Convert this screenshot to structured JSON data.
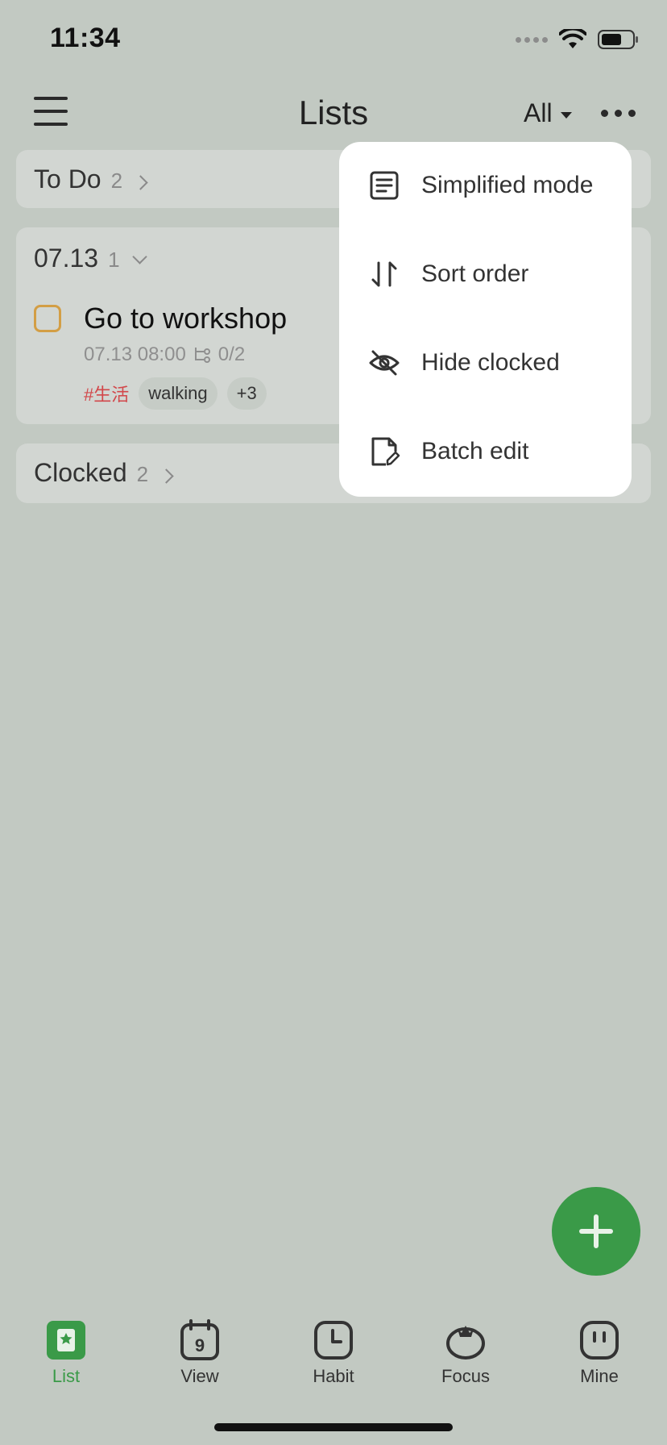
{
  "status_bar": {
    "time": "11:34"
  },
  "header": {
    "title": "Lists",
    "filter_label": "All"
  },
  "sections": {
    "todo": {
      "title": "To Do",
      "count": "2"
    },
    "date": {
      "title": "07.13",
      "count": "1"
    },
    "clocked": {
      "title": "Clocked",
      "count": "2"
    }
  },
  "task": {
    "title": "Go to workshop",
    "datetime": "07.13 08:00",
    "subtask_progress": "0/2",
    "tag_primary": "#生活",
    "tag_secondary": "walking",
    "tag_more": "+3"
  },
  "menu": {
    "items": [
      {
        "label": "Simplified mode",
        "icon": "document-icon"
      },
      {
        "label": "Sort order",
        "icon": "sort-icon"
      },
      {
        "label": "Hide clocked",
        "icon": "eye-off-icon"
      },
      {
        "label": "Batch edit",
        "icon": "edit-document-icon"
      }
    ]
  },
  "tabbar": {
    "items": [
      {
        "label": "List",
        "icon": "list-icon",
        "active": true
      },
      {
        "label": "View",
        "icon": "calendar-icon",
        "calendar_day": "9"
      },
      {
        "label": "Habit",
        "icon": "clock-icon"
      },
      {
        "label": "Focus",
        "icon": "tomato-icon"
      },
      {
        "label": "Mine",
        "icon": "profile-icon"
      }
    ]
  },
  "colors": {
    "background": "#c2c9c2",
    "accent": "#3a9a48",
    "checkbox": "#d39e45",
    "tag_red": "#d2474a"
  }
}
